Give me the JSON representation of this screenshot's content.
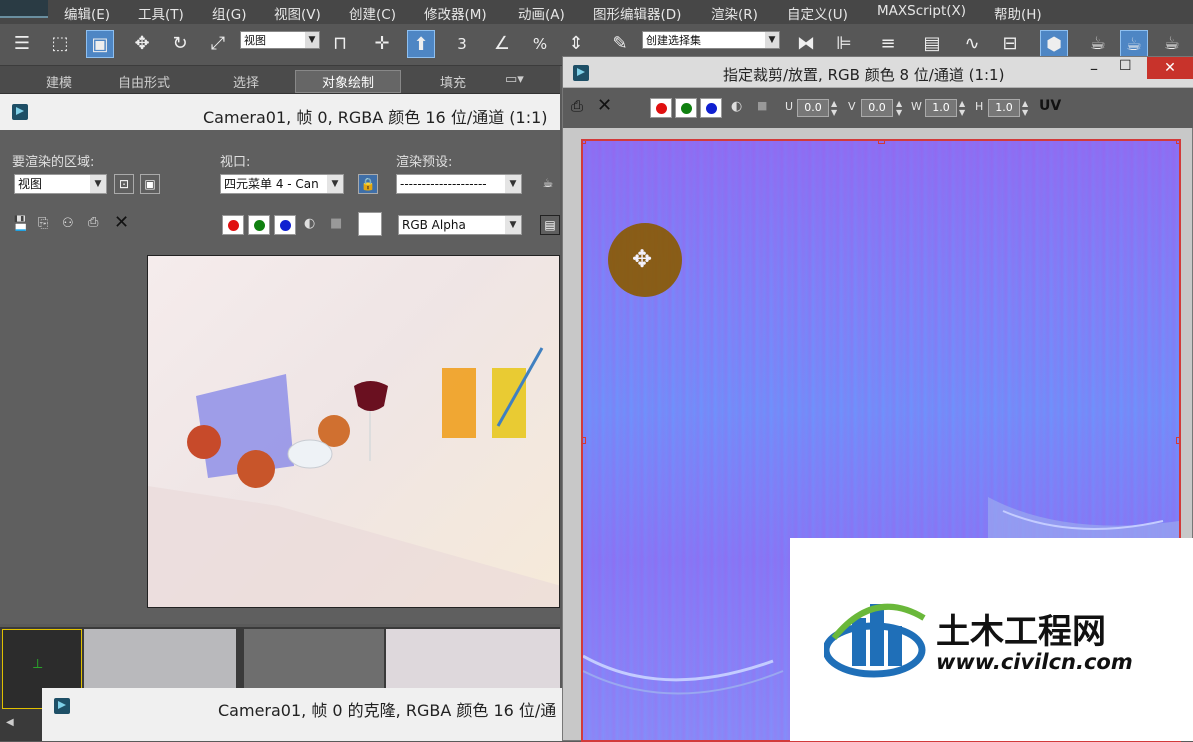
{
  "menu": [
    "编辑(E)",
    "工具(T)",
    "组(G)",
    "视图(V)",
    "创建(C)",
    "修改器(M)",
    "动画(A)",
    "图形编辑器(D)",
    "渲染(R)",
    "自定义(U)",
    "MAXScript(X)",
    "帮助(H)"
  ],
  "toolbar": {
    "view_select": "视图",
    "selection_set": "创建选择集",
    "snap_3": "3",
    "snap_percent": "%"
  },
  "ribbon": {
    "tabs": [
      "建模",
      "自由形式",
      "选择",
      "对象绘制",
      "填充"
    ]
  },
  "render_window": {
    "title": "Camera01, 帧 0, RGBA 颜色 16 位/通道 (1:1)",
    "area_label": "要渲染的区域:",
    "area_value": "视图",
    "viewport_label": "视口:",
    "viewport_value": "四元菜单 4 - Can",
    "preset_label": "渲染预设:",
    "preset_value": "--------------------",
    "channel_value": "RGB Alpha"
  },
  "clone_window": {
    "title": "Camera01, 帧 0 的克隆, RGBA 颜色 16 位/通"
  },
  "crop_window": {
    "title": "指定裁剪/放置, RGB 颜色 8 位/通道 (1:1)",
    "u_label": "U",
    "u_value": "0.0",
    "v_label": "V",
    "v_value": "0.0",
    "w_label": "W",
    "w_value": "1.0",
    "h_label": "H",
    "h_value": "1.0",
    "uv_label": "UV"
  },
  "watermark": {
    "name": "土木工程网",
    "url": "www.civilcn.com"
  },
  "colors": {
    "accent": "#4e86c4",
    "crop_border": "#d23a3a",
    "move_cursor": "#8a5a00"
  }
}
